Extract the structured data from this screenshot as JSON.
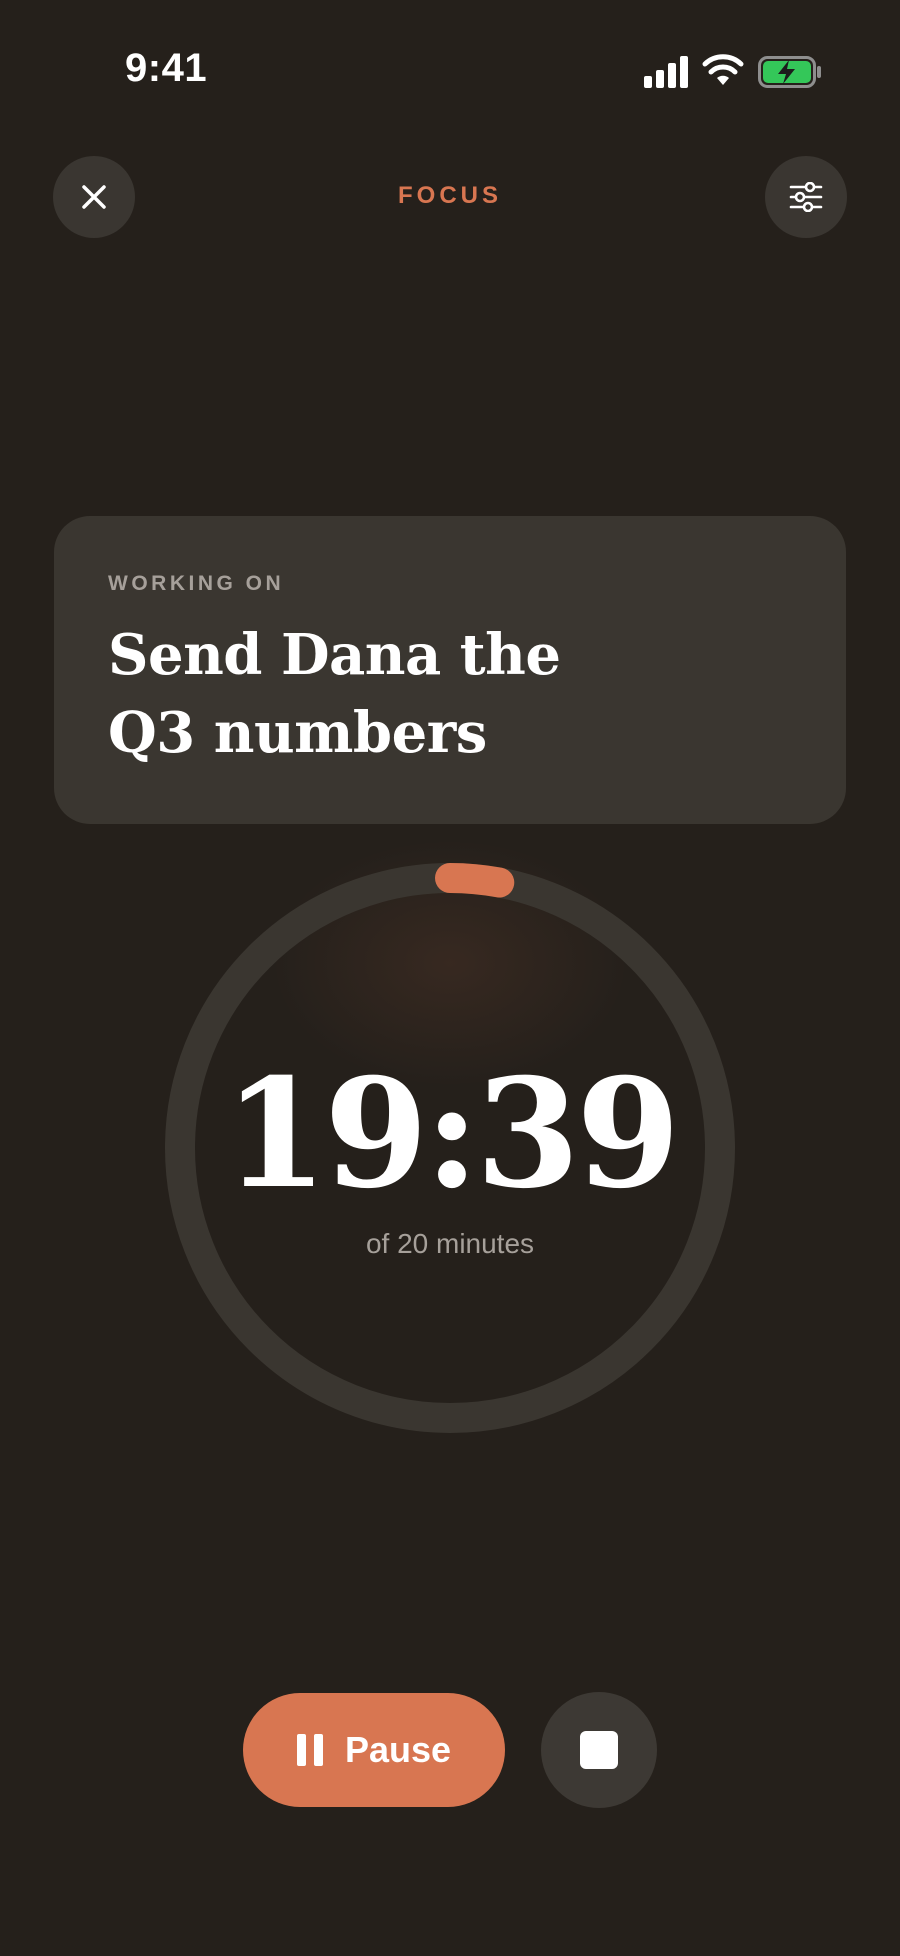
{
  "status_bar": {
    "time": "9:41",
    "icons": [
      "signal-icon",
      "wifi-icon",
      "battery-charging-icon"
    ]
  },
  "header": {
    "title": "FOCUS",
    "close_icon": "close-icon",
    "settings_icon": "sliders-icon"
  },
  "task": {
    "eyebrow": "WORKING ON",
    "title_line1": "Send Dana the",
    "title_line2": "Q3 numbers"
  },
  "timer": {
    "remaining": "19:39",
    "total_label": "of 20 minutes",
    "progress_fraction": 0.0292
  },
  "controls": {
    "pause_label": "Pause",
    "pause_icon": "pause-icon",
    "stop_icon": "stop-icon"
  },
  "colors": {
    "background": "#25201b",
    "accent": "#d87651",
    "card": "#3a3630",
    "track": "#3a3630",
    "muted_text": "#a6a09a",
    "battery_green": "#34c759"
  }
}
